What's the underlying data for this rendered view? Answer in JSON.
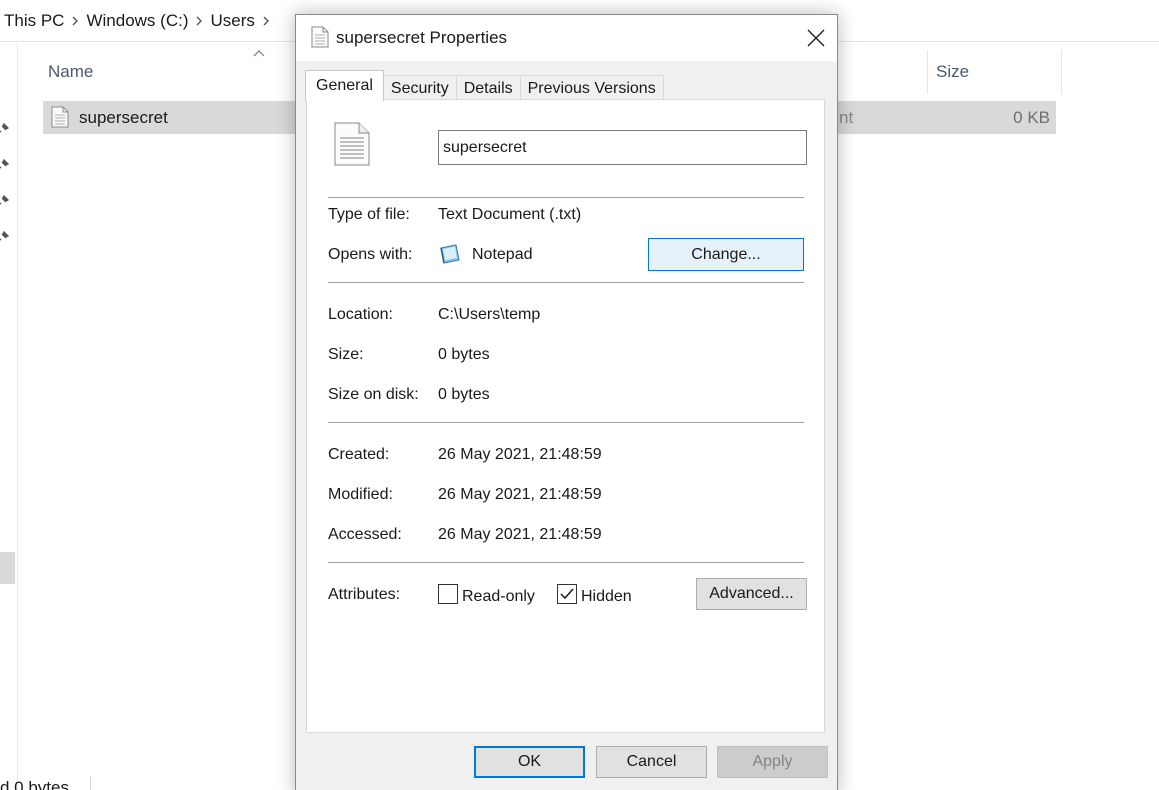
{
  "explorer": {
    "breadcrumb": [
      "This PC",
      "Windows (C:)",
      "Users",
      ""
    ],
    "columns": {
      "name": "Name",
      "size": "Size"
    },
    "file": {
      "name": "supersecret",
      "type_partial": "nt",
      "size": "0 KB"
    },
    "status": "d  0 bytes"
  },
  "dialog": {
    "title": "supersecret Properties",
    "tabs": [
      "General",
      "Security",
      "Details",
      "Previous Versions"
    ],
    "active_tab": "General",
    "filename": "supersecret",
    "fields": {
      "type_label": "Type of file:",
      "type_value": "Text Document (.txt)",
      "opens_label": "Opens with:",
      "opens_value": "Notepad",
      "change_button": "Change...",
      "location_label": "Location:",
      "location_value": "C:\\Users\\temp",
      "size_label": "Size:",
      "size_value": "0 bytes",
      "disk_label": "Size on disk:",
      "disk_value": "0 bytes",
      "created_label": "Created:",
      "created_value": "26 May 2021, 21:48:59",
      "modified_label": "Modified:",
      "modified_value": "26 May 2021, 21:48:59",
      "accessed_label": "Accessed:",
      "accessed_value": "26 May 2021, 21:48:59",
      "attributes_label": "Attributes:",
      "readonly_label": "Read-only",
      "readonly_checked": false,
      "hidden_label": "Hidden",
      "hidden_checked": true,
      "advanced_button": "Advanced..."
    },
    "buttons": {
      "ok": "OK",
      "cancel": "Cancel",
      "apply": "Apply"
    },
    "apply_enabled": false
  },
  "colors": {
    "accent": "#0078d7",
    "selection": "#d9d9d9",
    "change_button_bg": "#e5f1fb"
  },
  "icons": [
    "chevron-right-icon",
    "sort-up-icon",
    "pin-icon",
    "text-file-icon",
    "notepad-icon",
    "close-icon",
    "checkmark-icon"
  ]
}
